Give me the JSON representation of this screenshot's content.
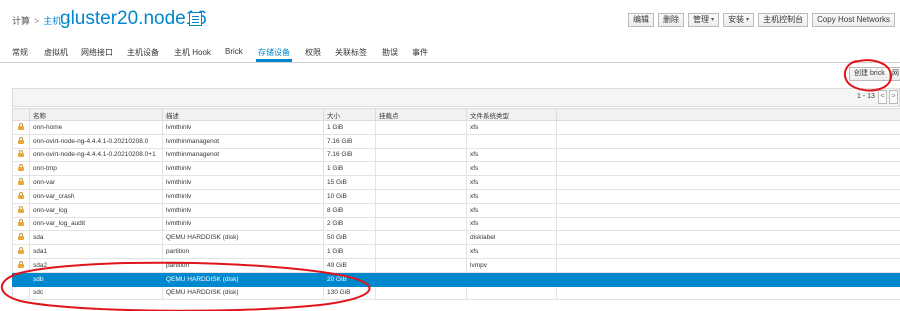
{
  "breadcrumb": {
    "compute": "计算",
    "separator": ">",
    "hosts": "主机"
  },
  "page_title": "gluster20.node16",
  "actions": {
    "edit": "编辑",
    "remove": "删除",
    "management": "管理",
    "installation": "安装",
    "host_console": "主机控制台",
    "copy_host_networks": "Copy Host Networks"
  },
  "tabs": [
    {
      "label": "常规",
      "active": false
    },
    {
      "label": "虚拟机",
      "active": false
    },
    {
      "label": "网络接口",
      "active": false
    },
    {
      "label": "主机设备",
      "active": false
    },
    {
      "label": "主机 Hook",
      "active": false
    },
    {
      "label": "Brick",
      "active": false
    },
    {
      "label": "存储设备",
      "active": true
    },
    {
      "label": "权限",
      "active": false
    },
    {
      "label": "关联标签",
      "active": false
    },
    {
      "label": "勘误",
      "active": false
    },
    {
      "label": "事件",
      "active": false
    }
  ],
  "toolbar": {
    "create_brick": "创建 brick",
    "next_label": "网"
  },
  "pager": {
    "range": "1 - 13",
    "prev": "<",
    "next": ">"
  },
  "table": {
    "columns": [
      "名称",
      "描述",
      "大小",
      "挂载点",
      "文件系统类型"
    ],
    "rows": [
      {
        "locked": true,
        "selected": false,
        "name": "onn-home",
        "desc": "lvmthinlv",
        "size": "1 GiB",
        "mount": "",
        "fs": "xfs"
      },
      {
        "locked": true,
        "selected": false,
        "name": "onn-ovirt-node-ng-4.4.4.1-0.20210208.0",
        "desc": "lvmthinmanagenot",
        "size": "7.16 GiB",
        "mount": "",
        "fs": ""
      },
      {
        "locked": true,
        "selected": false,
        "name": "onn-ovirt-node-ng-4.4.4.1-0.20210208.0+1",
        "desc": "lvmthinmanagenot",
        "size": "7.16 GiB",
        "mount": "",
        "fs": "xfs"
      },
      {
        "locked": true,
        "selected": false,
        "name": "onn-tmp",
        "desc": "lvmthinlv",
        "size": "1 GiB",
        "mount": "",
        "fs": "xfs"
      },
      {
        "locked": true,
        "selected": false,
        "name": "onn-var",
        "desc": "lvmthinlv",
        "size": "15 GiB",
        "mount": "",
        "fs": "xfs"
      },
      {
        "locked": true,
        "selected": false,
        "name": "onn-var_crash",
        "desc": "lvmthinlv",
        "size": "10 GiB",
        "mount": "",
        "fs": "xfs"
      },
      {
        "locked": true,
        "selected": false,
        "name": "onn-var_log",
        "desc": "lvmthinlv",
        "size": "8 GiB",
        "mount": "",
        "fs": "xfs"
      },
      {
        "locked": true,
        "selected": false,
        "name": "onn-var_log_audit",
        "desc": "lvmthinlv",
        "size": "2 GiB",
        "mount": "",
        "fs": "xfs"
      },
      {
        "locked": true,
        "selected": false,
        "name": "sda",
        "desc": "QEMU HARDDISK (disk)",
        "size": "50 GiB",
        "mount": "",
        "fs": "disklabel"
      },
      {
        "locked": true,
        "selected": false,
        "name": "sda1",
        "desc": "partition",
        "size": "1 GiB",
        "mount": "",
        "fs": "xfs"
      },
      {
        "locked": true,
        "selected": false,
        "name": "sda2",
        "desc": "partition",
        "size": "49 GiB",
        "mount": "",
        "fs": "lvmpv"
      },
      {
        "locked": false,
        "selected": true,
        "name": "sdb",
        "desc": "QEMU HARDDISK (disk)",
        "size": "20 GiB",
        "mount": "",
        "fs": ""
      },
      {
        "locked": false,
        "selected": false,
        "name": "sdc",
        "desc": "QEMU HARDDISK (disk)",
        "size": "130 GiB",
        "mount": "",
        "fs": ""
      }
    ]
  },
  "colors": {
    "accent": "#0088ce",
    "annotation": "#e0151b",
    "selection": "#0088ce",
    "lock": "#e8a93a"
  },
  "icons": {
    "lock": "lock-icon",
    "menu": "hamburger-icon",
    "caret": "caret-down-icon"
  }
}
